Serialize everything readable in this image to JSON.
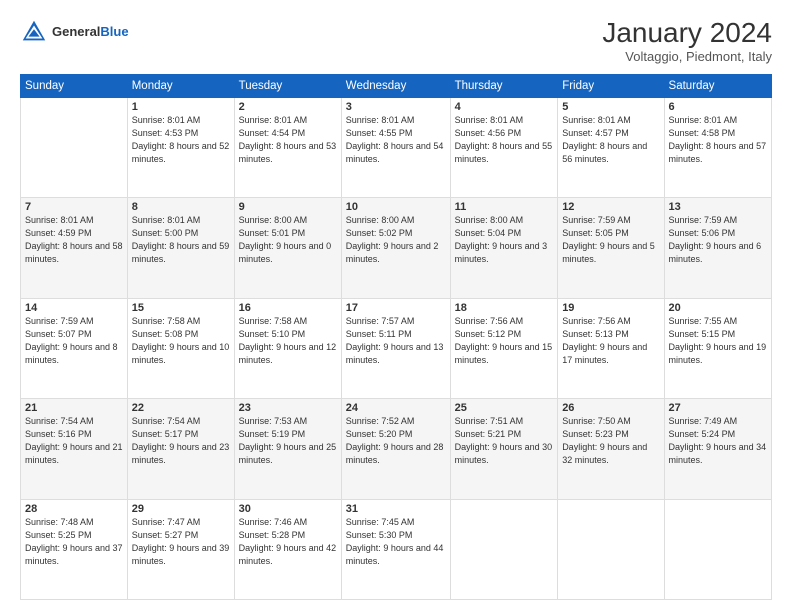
{
  "header": {
    "logo_general": "General",
    "logo_blue": "Blue",
    "month_title": "January 2024",
    "location": "Voltaggio, Piedmont, Italy"
  },
  "weekdays": [
    "Sunday",
    "Monday",
    "Tuesday",
    "Wednesday",
    "Thursday",
    "Friday",
    "Saturday"
  ],
  "weeks": [
    [
      {
        "day": "",
        "sunrise": "",
        "sunset": "",
        "daylight": ""
      },
      {
        "day": "1",
        "sunrise": "Sunrise: 8:01 AM",
        "sunset": "Sunset: 4:53 PM",
        "daylight": "Daylight: 8 hours and 52 minutes."
      },
      {
        "day": "2",
        "sunrise": "Sunrise: 8:01 AM",
        "sunset": "Sunset: 4:54 PM",
        "daylight": "Daylight: 8 hours and 53 minutes."
      },
      {
        "day": "3",
        "sunrise": "Sunrise: 8:01 AM",
        "sunset": "Sunset: 4:55 PM",
        "daylight": "Daylight: 8 hours and 54 minutes."
      },
      {
        "day": "4",
        "sunrise": "Sunrise: 8:01 AM",
        "sunset": "Sunset: 4:56 PM",
        "daylight": "Daylight: 8 hours and 55 minutes."
      },
      {
        "day": "5",
        "sunrise": "Sunrise: 8:01 AM",
        "sunset": "Sunset: 4:57 PM",
        "daylight": "Daylight: 8 hours and 56 minutes."
      },
      {
        "day": "6",
        "sunrise": "Sunrise: 8:01 AM",
        "sunset": "Sunset: 4:58 PM",
        "daylight": "Daylight: 8 hours and 57 minutes."
      }
    ],
    [
      {
        "day": "7",
        "sunrise": "Sunrise: 8:01 AM",
        "sunset": "Sunset: 4:59 PM",
        "daylight": "Daylight: 8 hours and 58 minutes."
      },
      {
        "day": "8",
        "sunrise": "Sunrise: 8:01 AM",
        "sunset": "Sunset: 5:00 PM",
        "daylight": "Daylight: 8 hours and 59 minutes."
      },
      {
        "day": "9",
        "sunrise": "Sunrise: 8:00 AM",
        "sunset": "Sunset: 5:01 PM",
        "daylight": "Daylight: 9 hours and 0 minutes."
      },
      {
        "day": "10",
        "sunrise": "Sunrise: 8:00 AM",
        "sunset": "Sunset: 5:02 PM",
        "daylight": "Daylight: 9 hours and 2 minutes."
      },
      {
        "day": "11",
        "sunrise": "Sunrise: 8:00 AM",
        "sunset": "Sunset: 5:04 PM",
        "daylight": "Daylight: 9 hours and 3 minutes."
      },
      {
        "day": "12",
        "sunrise": "Sunrise: 7:59 AM",
        "sunset": "Sunset: 5:05 PM",
        "daylight": "Daylight: 9 hours and 5 minutes."
      },
      {
        "day": "13",
        "sunrise": "Sunrise: 7:59 AM",
        "sunset": "Sunset: 5:06 PM",
        "daylight": "Daylight: 9 hours and 6 minutes."
      }
    ],
    [
      {
        "day": "14",
        "sunrise": "Sunrise: 7:59 AM",
        "sunset": "Sunset: 5:07 PM",
        "daylight": "Daylight: 9 hours and 8 minutes."
      },
      {
        "day": "15",
        "sunrise": "Sunrise: 7:58 AM",
        "sunset": "Sunset: 5:08 PM",
        "daylight": "Daylight: 9 hours and 10 minutes."
      },
      {
        "day": "16",
        "sunrise": "Sunrise: 7:58 AM",
        "sunset": "Sunset: 5:10 PM",
        "daylight": "Daylight: 9 hours and 12 minutes."
      },
      {
        "day": "17",
        "sunrise": "Sunrise: 7:57 AM",
        "sunset": "Sunset: 5:11 PM",
        "daylight": "Daylight: 9 hours and 13 minutes."
      },
      {
        "day": "18",
        "sunrise": "Sunrise: 7:56 AM",
        "sunset": "Sunset: 5:12 PM",
        "daylight": "Daylight: 9 hours and 15 minutes."
      },
      {
        "day": "19",
        "sunrise": "Sunrise: 7:56 AM",
        "sunset": "Sunset: 5:13 PM",
        "daylight": "Daylight: 9 hours and 17 minutes."
      },
      {
        "day": "20",
        "sunrise": "Sunrise: 7:55 AM",
        "sunset": "Sunset: 5:15 PM",
        "daylight": "Daylight: 9 hours and 19 minutes."
      }
    ],
    [
      {
        "day": "21",
        "sunrise": "Sunrise: 7:54 AM",
        "sunset": "Sunset: 5:16 PM",
        "daylight": "Daylight: 9 hours and 21 minutes."
      },
      {
        "day": "22",
        "sunrise": "Sunrise: 7:54 AM",
        "sunset": "Sunset: 5:17 PM",
        "daylight": "Daylight: 9 hours and 23 minutes."
      },
      {
        "day": "23",
        "sunrise": "Sunrise: 7:53 AM",
        "sunset": "Sunset: 5:19 PM",
        "daylight": "Daylight: 9 hours and 25 minutes."
      },
      {
        "day": "24",
        "sunrise": "Sunrise: 7:52 AM",
        "sunset": "Sunset: 5:20 PM",
        "daylight": "Daylight: 9 hours and 28 minutes."
      },
      {
        "day": "25",
        "sunrise": "Sunrise: 7:51 AM",
        "sunset": "Sunset: 5:21 PM",
        "daylight": "Daylight: 9 hours and 30 minutes."
      },
      {
        "day": "26",
        "sunrise": "Sunrise: 7:50 AM",
        "sunset": "Sunset: 5:23 PM",
        "daylight": "Daylight: 9 hours and 32 minutes."
      },
      {
        "day": "27",
        "sunrise": "Sunrise: 7:49 AM",
        "sunset": "Sunset: 5:24 PM",
        "daylight": "Daylight: 9 hours and 34 minutes."
      }
    ],
    [
      {
        "day": "28",
        "sunrise": "Sunrise: 7:48 AM",
        "sunset": "Sunset: 5:25 PM",
        "daylight": "Daylight: 9 hours and 37 minutes."
      },
      {
        "day": "29",
        "sunrise": "Sunrise: 7:47 AM",
        "sunset": "Sunset: 5:27 PM",
        "daylight": "Daylight: 9 hours and 39 minutes."
      },
      {
        "day": "30",
        "sunrise": "Sunrise: 7:46 AM",
        "sunset": "Sunset: 5:28 PM",
        "daylight": "Daylight: 9 hours and 42 minutes."
      },
      {
        "day": "31",
        "sunrise": "Sunrise: 7:45 AM",
        "sunset": "Sunset: 5:30 PM",
        "daylight": "Daylight: 9 hours and 44 minutes."
      },
      {
        "day": "",
        "sunrise": "",
        "sunset": "",
        "daylight": ""
      },
      {
        "day": "",
        "sunrise": "",
        "sunset": "",
        "daylight": ""
      },
      {
        "day": "",
        "sunrise": "",
        "sunset": "",
        "daylight": ""
      }
    ]
  ]
}
